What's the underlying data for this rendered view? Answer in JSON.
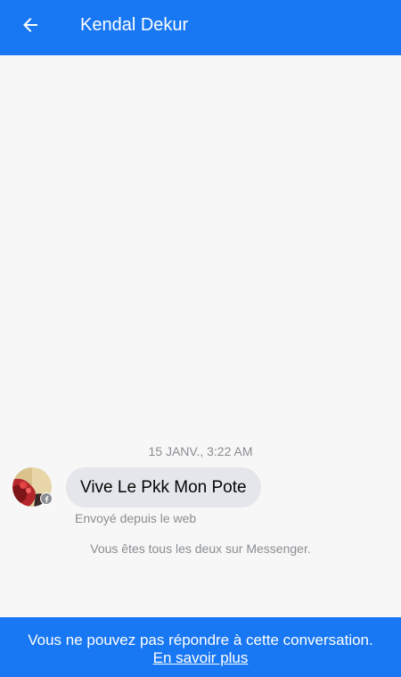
{
  "header": {
    "title": "Kendal Dekur",
    "back_icon": "arrow-left-icon"
  },
  "conversation": {
    "timestamp": "15 JANV., 3:22 AM",
    "message": {
      "text": "Vive Le Pkk Mon Pote",
      "sent_via": "Envoyé depuis le web",
      "avatar_badge_icon": "facebook-icon"
    },
    "info": "Vous êtes tous les deux sur Messenger."
  },
  "footer": {
    "notice": "Vous ne pouvez pas répondre à cette conversation.",
    "learn_more": "En savoir plus"
  },
  "colors": {
    "brand": "#1877f2",
    "background": "#f7f7f7",
    "bubble": "#e4e6eb",
    "muted_text": "#8a8d91"
  }
}
